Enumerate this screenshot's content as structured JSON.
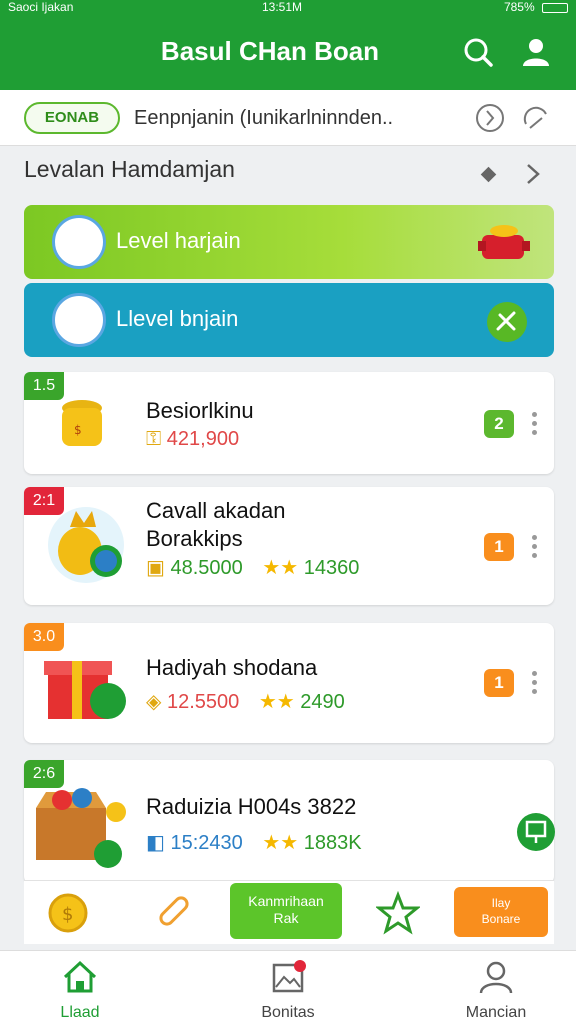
{
  "status_bar": {
    "carrier": "Saoci Ijakan",
    "time": "13:51M",
    "battery": "785%"
  },
  "header": {
    "title": "Basul CHan Boan",
    "icons": [
      "search-icon",
      "user-icon"
    ]
  },
  "search_row": {
    "badge": "EONAB",
    "text": "Eenpnjanin (Iunikarlninnden..",
    "icons": [
      "clock-icon",
      "refresh-icon"
    ]
  },
  "section": {
    "title": "Levalan Hamdamjan",
    "icons": [
      "diamond-icon",
      "chevron-right-icon"
    ]
  },
  "levels": [
    {
      "label": "Level harjain",
      "color": "#7cc823"
    },
    {
      "label": "Llevel bnjain",
      "color": "#1aa0c2"
    }
  ],
  "cards": [
    {
      "rank": "1.5",
      "rank_color": "#3aa52b",
      "name": "Besiorlkinu",
      "stat1": "421,900",
      "stat1_color": "#e04848",
      "stat2": "",
      "pill": "2",
      "pill_color": "#5cb82e"
    },
    {
      "rank": "2:1",
      "rank_color": "#e2263a",
      "name": "Cavall akadan Borakkips",
      "stat1": "48.5000",
      "stat1_color": "#2e9a2a",
      "stat2": "14360",
      "pill": "1",
      "pill_color": "#f98e1d"
    },
    {
      "rank": "3.0",
      "rank_color": "#f98e1d",
      "name": "Hadiyah shodana",
      "stat1": "12.5500",
      "stat1_color": "#e04848",
      "stat2": "2490",
      "pill": "1",
      "pill_color": "#f98e1d"
    },
    {
      "rank": "2:6",
      "rank_color": "#3aa52b",
      "name": "Raduizia H004s 3822",
      "stat1": "15:2430",
      "stat1_color": "#2c7fc6",
      "stat2": "1883K",
      "pill": "",
      "pill_color": "#3aa52b"
    }
  ],
  "action_bar": {
    "green_button": [
      "Kanmrihaan",
      "Rak"
    ],
    "orange_button": [
      "Ilay",
      "Bonare"
    ]
  },
  "bottom_nav": [
    {
      "label": "Llaad",
      "icon": "home-icon",
      "active": true
    },
    {
      "label": "Bonitas",
      "icon": "gallery-icon",
      "active": false
    },
    {
      "label": "Mancian",
      "icon": "profile-icon",
      "active": false
    }
  ],
  "colors": {
    "primary": "#1f9e34",
    "accent_orange": "#f98e1d",
    "accent_blue": "#1aa0c2"
  }
}
